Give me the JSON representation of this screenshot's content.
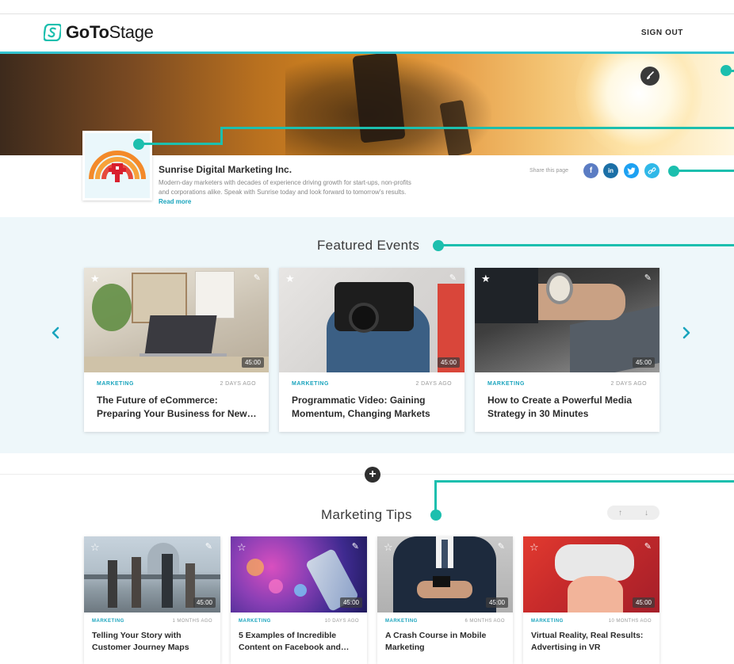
{
  "header": {
    "logo_bold": "GoTo",
    "logo_light": "Stage",
    "sign_out": "SIGN OUT"
  },
  "company": {
    "name": "Sunrise Digital Marketing Inc.",
    "description": "Modern-day marketers with decades of experience driving growth for start-ups, non-profits and corporations alike. Speak with Sunrise today and look forward to tomorrow's results.",
    "read_more": "Read more",
    "share_label": "Share this page",
    "social": [
      "f",
      "in",
      "t",
      "link"
    ]
  },
  "featured": {
    "title": "Featured Events",
    "prev": "‹",
    "next": "›",
    "cards": [
      {
        "category": "MARKETING",
        "ago": "2 DAYS AGO",
        "title": "The Future of eCommerce: Preparing Your Business for New…",
        "duration": "45:00"
      },
      {
        "category": "MARKETING",
        "ago": "2 DAYS AGO",
        "title": "Programmatic Video: Gaining Momentum, Changing Markets",
        "duration": "45:00"
      },
      {
        "category": "MARKETING",
        "ago": "2 DAYS AGO",
        "title": "How to Create a Powerful Media Strategy in 30 Minutes",
        "duration": "45:00"
      }
    ]
  },
  "tips": {
    "title": "Marketing Tips",
    "sort_up": "↑",
    "sort_down": "↓",
    "cards": [
      {
        "category": "MARKETING",
        "ago": "1 MONTHS AGO",
        "title": "Telling Your Story with Customer Journey Maps",
        "duration": "45:00"
      },
      {
        "category": "MARKETING",
        "ago": "10 DAYS AGO",
        "title": "5 Examples of Incredible Content on Facebook and…",
        "duration": "45:00"
      },
      {
        "category": "MARKETING",
        "ago": "6 MONTHS AGO",
        "title": "A Crash Course in Mobile Marketing",
        "duration": "45:00"
      },
      {
        "category": "MARKETING",
        "ago": "10 MONTHS AGO",
        "title": "Virtual Reality, Real Results: Advertising in VR",
        "duration": "45:00"
      }
    ]
  },
  "colors": {
    "accent": "#19a4bd",
    "annotation": "#1cbfae",
    "header_rule": "#33c3d0"
  }
}
